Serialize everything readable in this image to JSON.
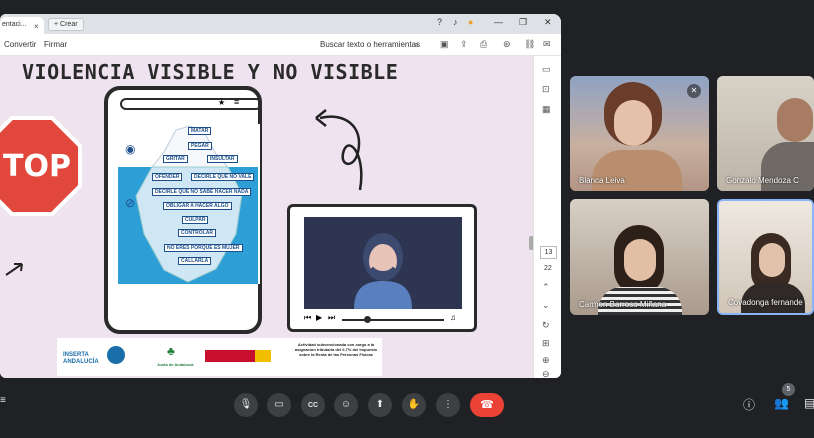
{
  "browser": {
    "tab_title": "entaci...",
    "new_tab_label": "Crear",
    "close_glyph": "×",
    "window_controls": {
      "minimize": "—",
      "maximize": "❐",
      "close": "✕"
    }
  },
  "pdf_toolbar": {
    "convert_label": "Convertir",
    "sign_label": "Firmar",
    "search_placeholder": "Buscar texto o herramientas"
  },
  "slide": {
    "title": "VIOLENCIA VISIBLE Y NO VISIBLE",
    "stop_text": "TOP",
    "iceberg_labels": [
      "MATAR",
      "PEGAR",
      "GRITAR",
      "INSULTAR",
      "OFENDER",
      "DECIRLE QUE NO VALE",
      "DECIRLE QUE NO SABE HACER NADA",
      "OBLIGAR A HACER ALGO",
      "CULPAR",
      "CONTROLAR",
      "NO ERES PORQUE ES MUJER",
      "CALLARLA"
    ],
    "footer": {
      "logo1": "INSERTA ANDALUCÍA",
      "logo2": "Junta de Andalucía",
      "note": "Actividad subvencionada con cargo a la asignación tributaria del 0,7% del Impuesto sobre la Renta de las Personas Físicas"
    }
  },
  "pdf_rail": {
    "current_page": "13",
    "total_pages": "22"
  },
  "participants": [
    {
      "name": "Blanca Leiva",
      "muted": true
    },
    {
      "name": "Gonzalo Mendoza C",
      "muted": false
    },
    {
      "name": "Carmen Barroso Miñana",
      "muted": false
    },
    {
      "name": "Covadonga fernande",
      "muted": false
    }
  ],
  "meeting": {
    "participant_count": "5",
    "end_call_icon": "phone-hangup-icon"
  },
  "colors": {
    "meet_bg": "#202124",
    "end_call": "#ea4335",
    "slide_bg": "#efe3f0",
    "stop_red": "#e2473b",
    "sea_blue": "#2e9fd6",
    "active_tile_border": "#8ab4f8"
  }
}
